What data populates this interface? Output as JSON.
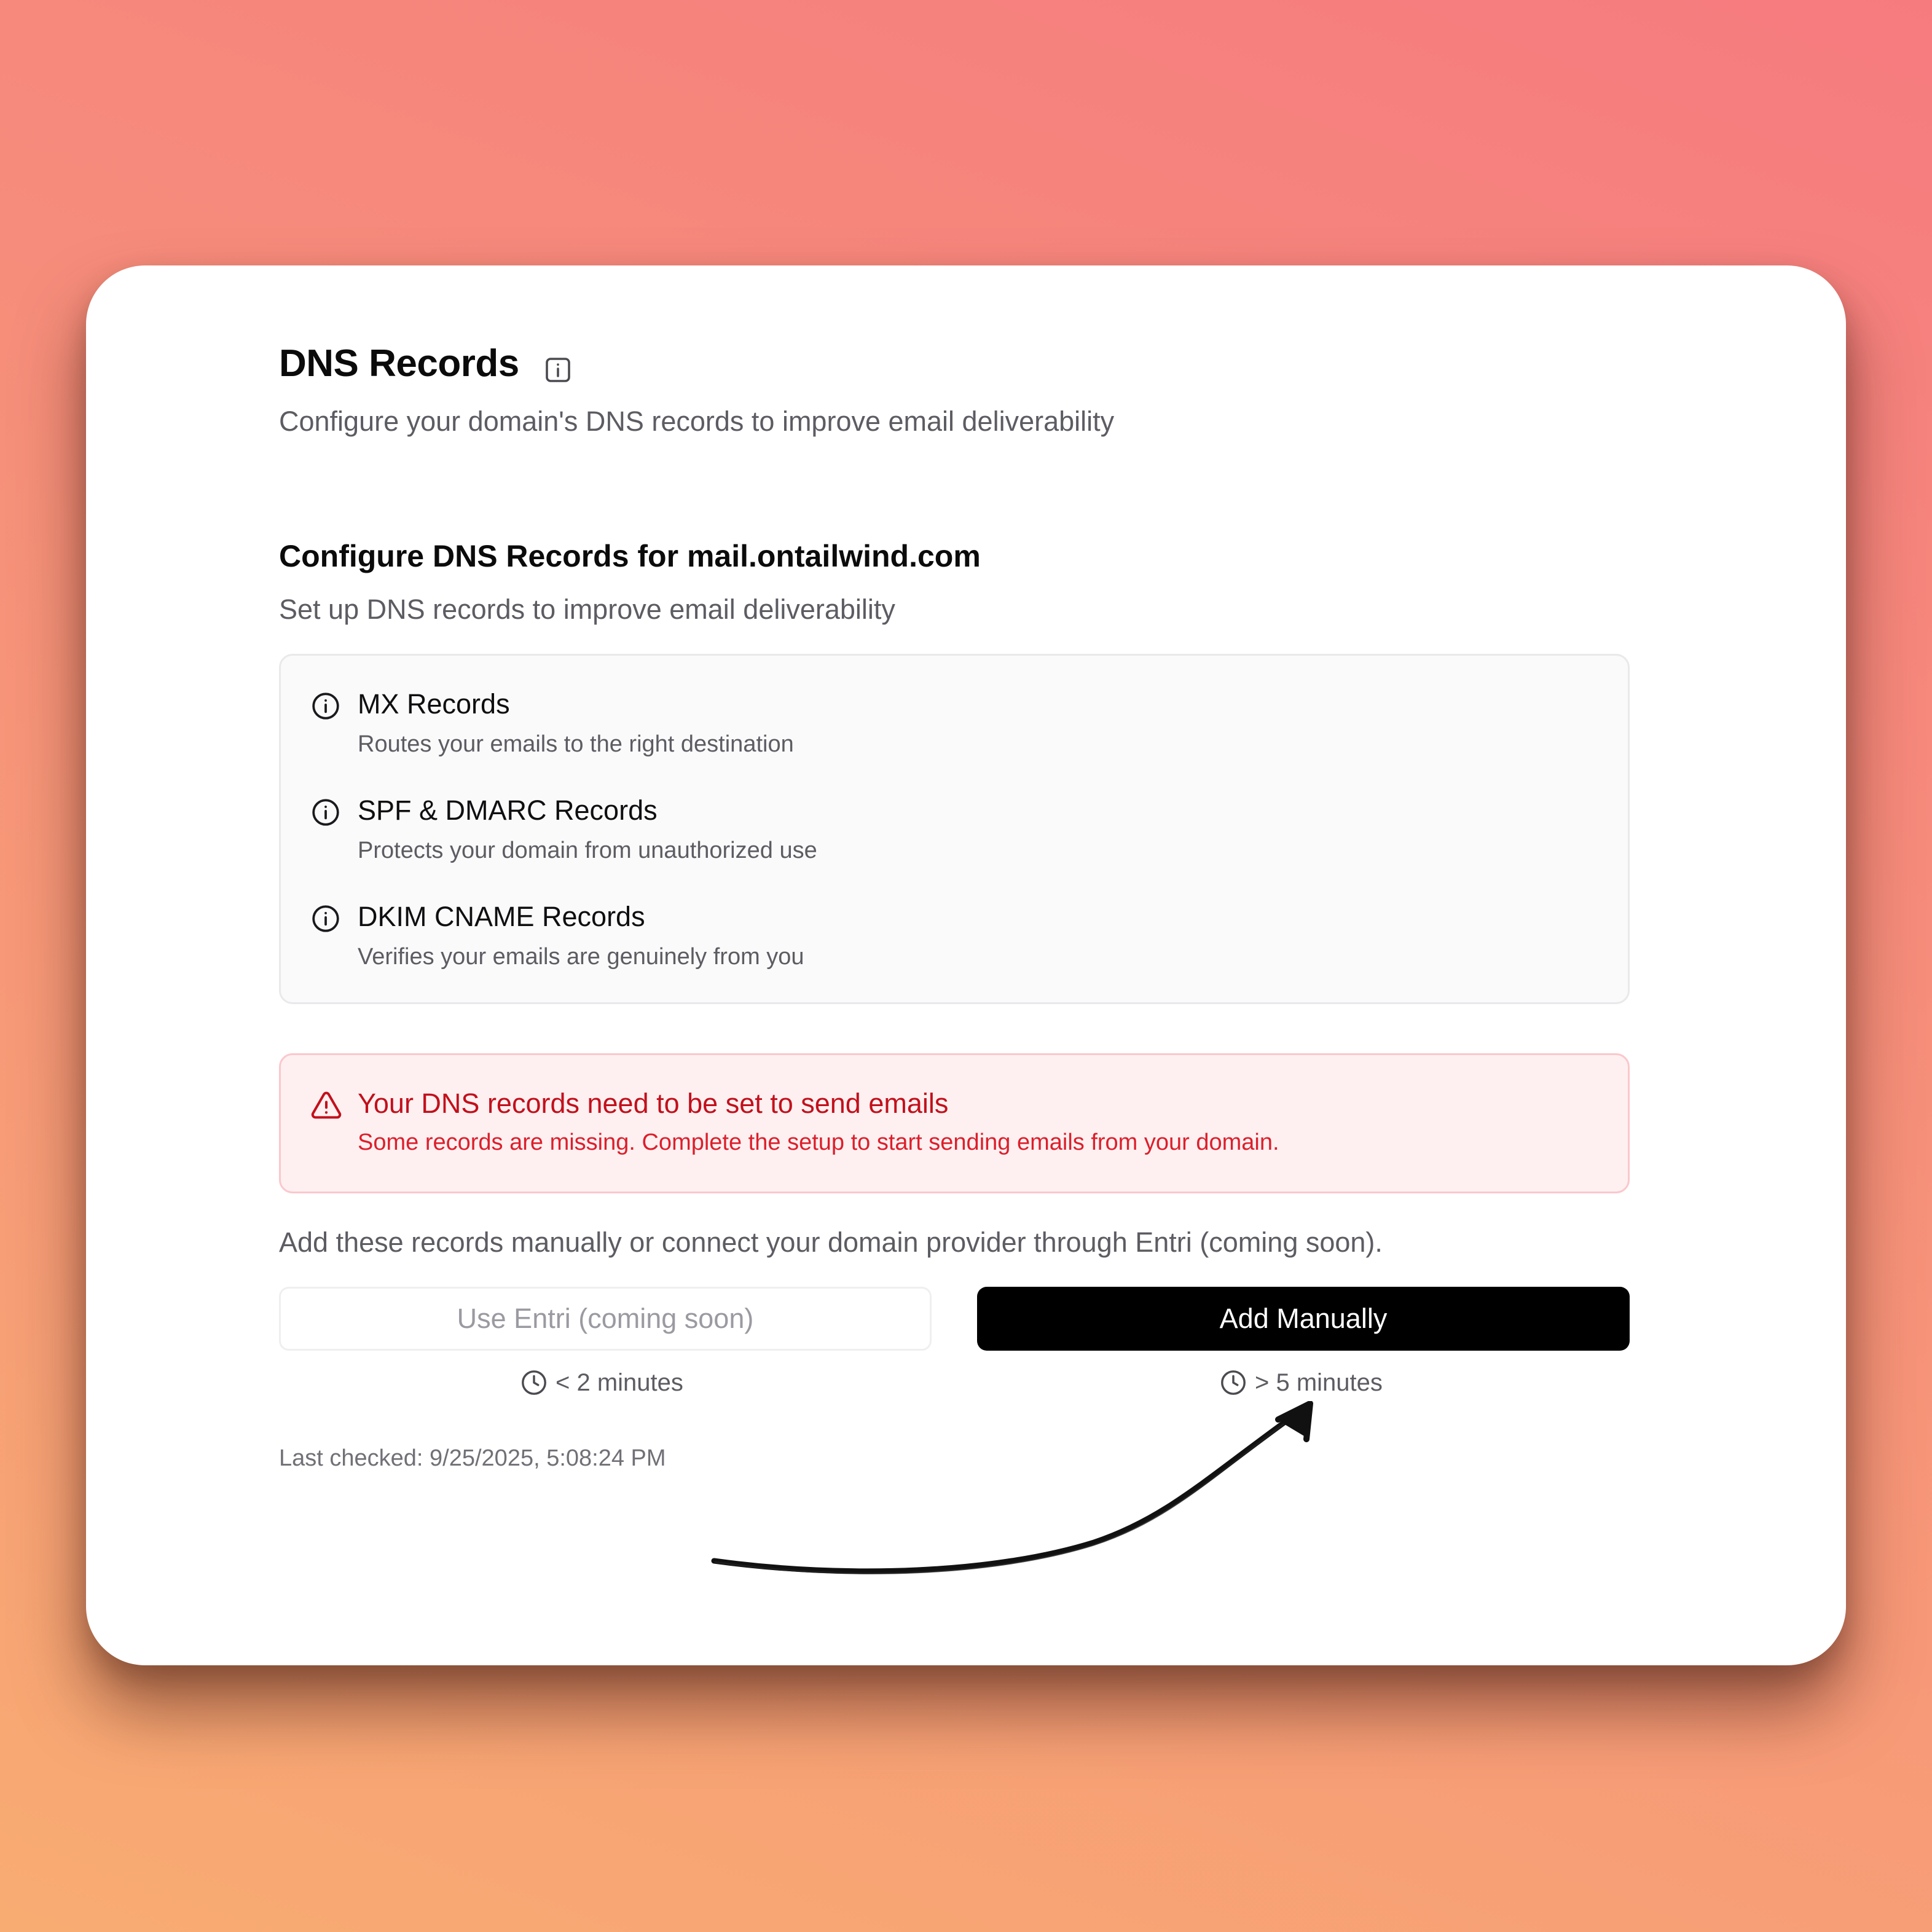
{
  "header": {
    "title": "DNS Records",
    "title_icon": "info-square-icon",
    "subtitle": "Configure your domain's DNS records to improve email deliverability"
  },
  "section": {
    "title": "Configure DNS Records for mail.ontailwind.com",
    "subtitle": "Set up DNS records to improve email deliverability"
  },
  "records": [
    {
      "icon": "info-circle-icon",
      "title": "MX Records",
      "description": "Routes your emails to the right destination"
    },
    {
      "icon": "info-circle-icon",
      "title": "SPF & DMARC Records",
      "description": "Protects your domain from unauthorized use"
    },
    {
      "icon": "info-circle-icon",
      "title": "DKIM CNAME Records",
      "description": "Verifies your emails are genuinely from you"
    }
  ],
  "alert": {
    "icon": "warning-triangle-icon",
    "title": "Your DNS records need to be set to send emails",
    "description": "Some records are missing. Complete the setup to start sending emails from your domain."
  },
  "instructions": "Add these records manually or connect your domain provider through Entri (coming soon).",
  "actions": {
    "entri": {
      "label": "Use Entri (coming soon)",
      "time": "< 2 minutes",
      "time_icon": "clock-icon"
    },
    "manual": {
      "label": "Add Manually",
      "time": "> 5 minutes",
      "time_icon": "clock-icon"
    }
  },
  "last_checked": "Last checked: 9/25/2025, 5:08:24 PM",
  "annotation": {
    "icon": "hand-drawn-arrow"
  },
  "colors": {
    "background_top": "#f67b7f",
    "background_bottom": "#f8ac72",
    "alert_text": "#c2101c",
    "alert_background": "#fef0f1",
    "primary_button": "#000000"
  }
}
